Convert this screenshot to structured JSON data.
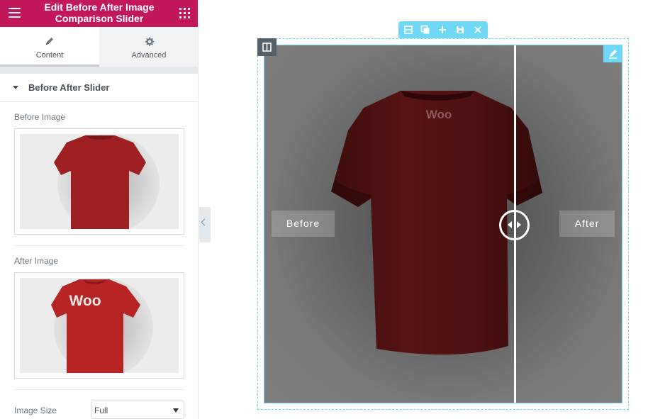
{
  "header": {
    "title": "Edit Before After Image\nComparison Slider",
    "menu_icon": "hamburger-icon",
    "apps_icon": "grid-icon"
  },
  "tabs": [
    {
      "label": "Content",
      "icon": "pencil-icon",
      "active": true
    },
    {
      "label": "Advanced",
      "icon": "gear-icon",
      "active": false
    }
  ],
  "section": {
    "title": "Before After Slider",
    "expanded": true
  },
  "controls": {
    "before_image_label": "Before Image",
    "after_image_label": "After Image",
    "image_size_label": "Image Size",
    "image_size_value": "Full"
  },
  "preview": {
    "before_label": "Before",
    "after_label": "After",
    "before_shirt_text": "Woo",
    "after_shirt_text": "Woo",
    "split_position": 0.7
  },
  "colors": {
    "brand": "#c2185b",
    "accent": "#71d7f7",
    "shirt": "#a32020"
  }
}
